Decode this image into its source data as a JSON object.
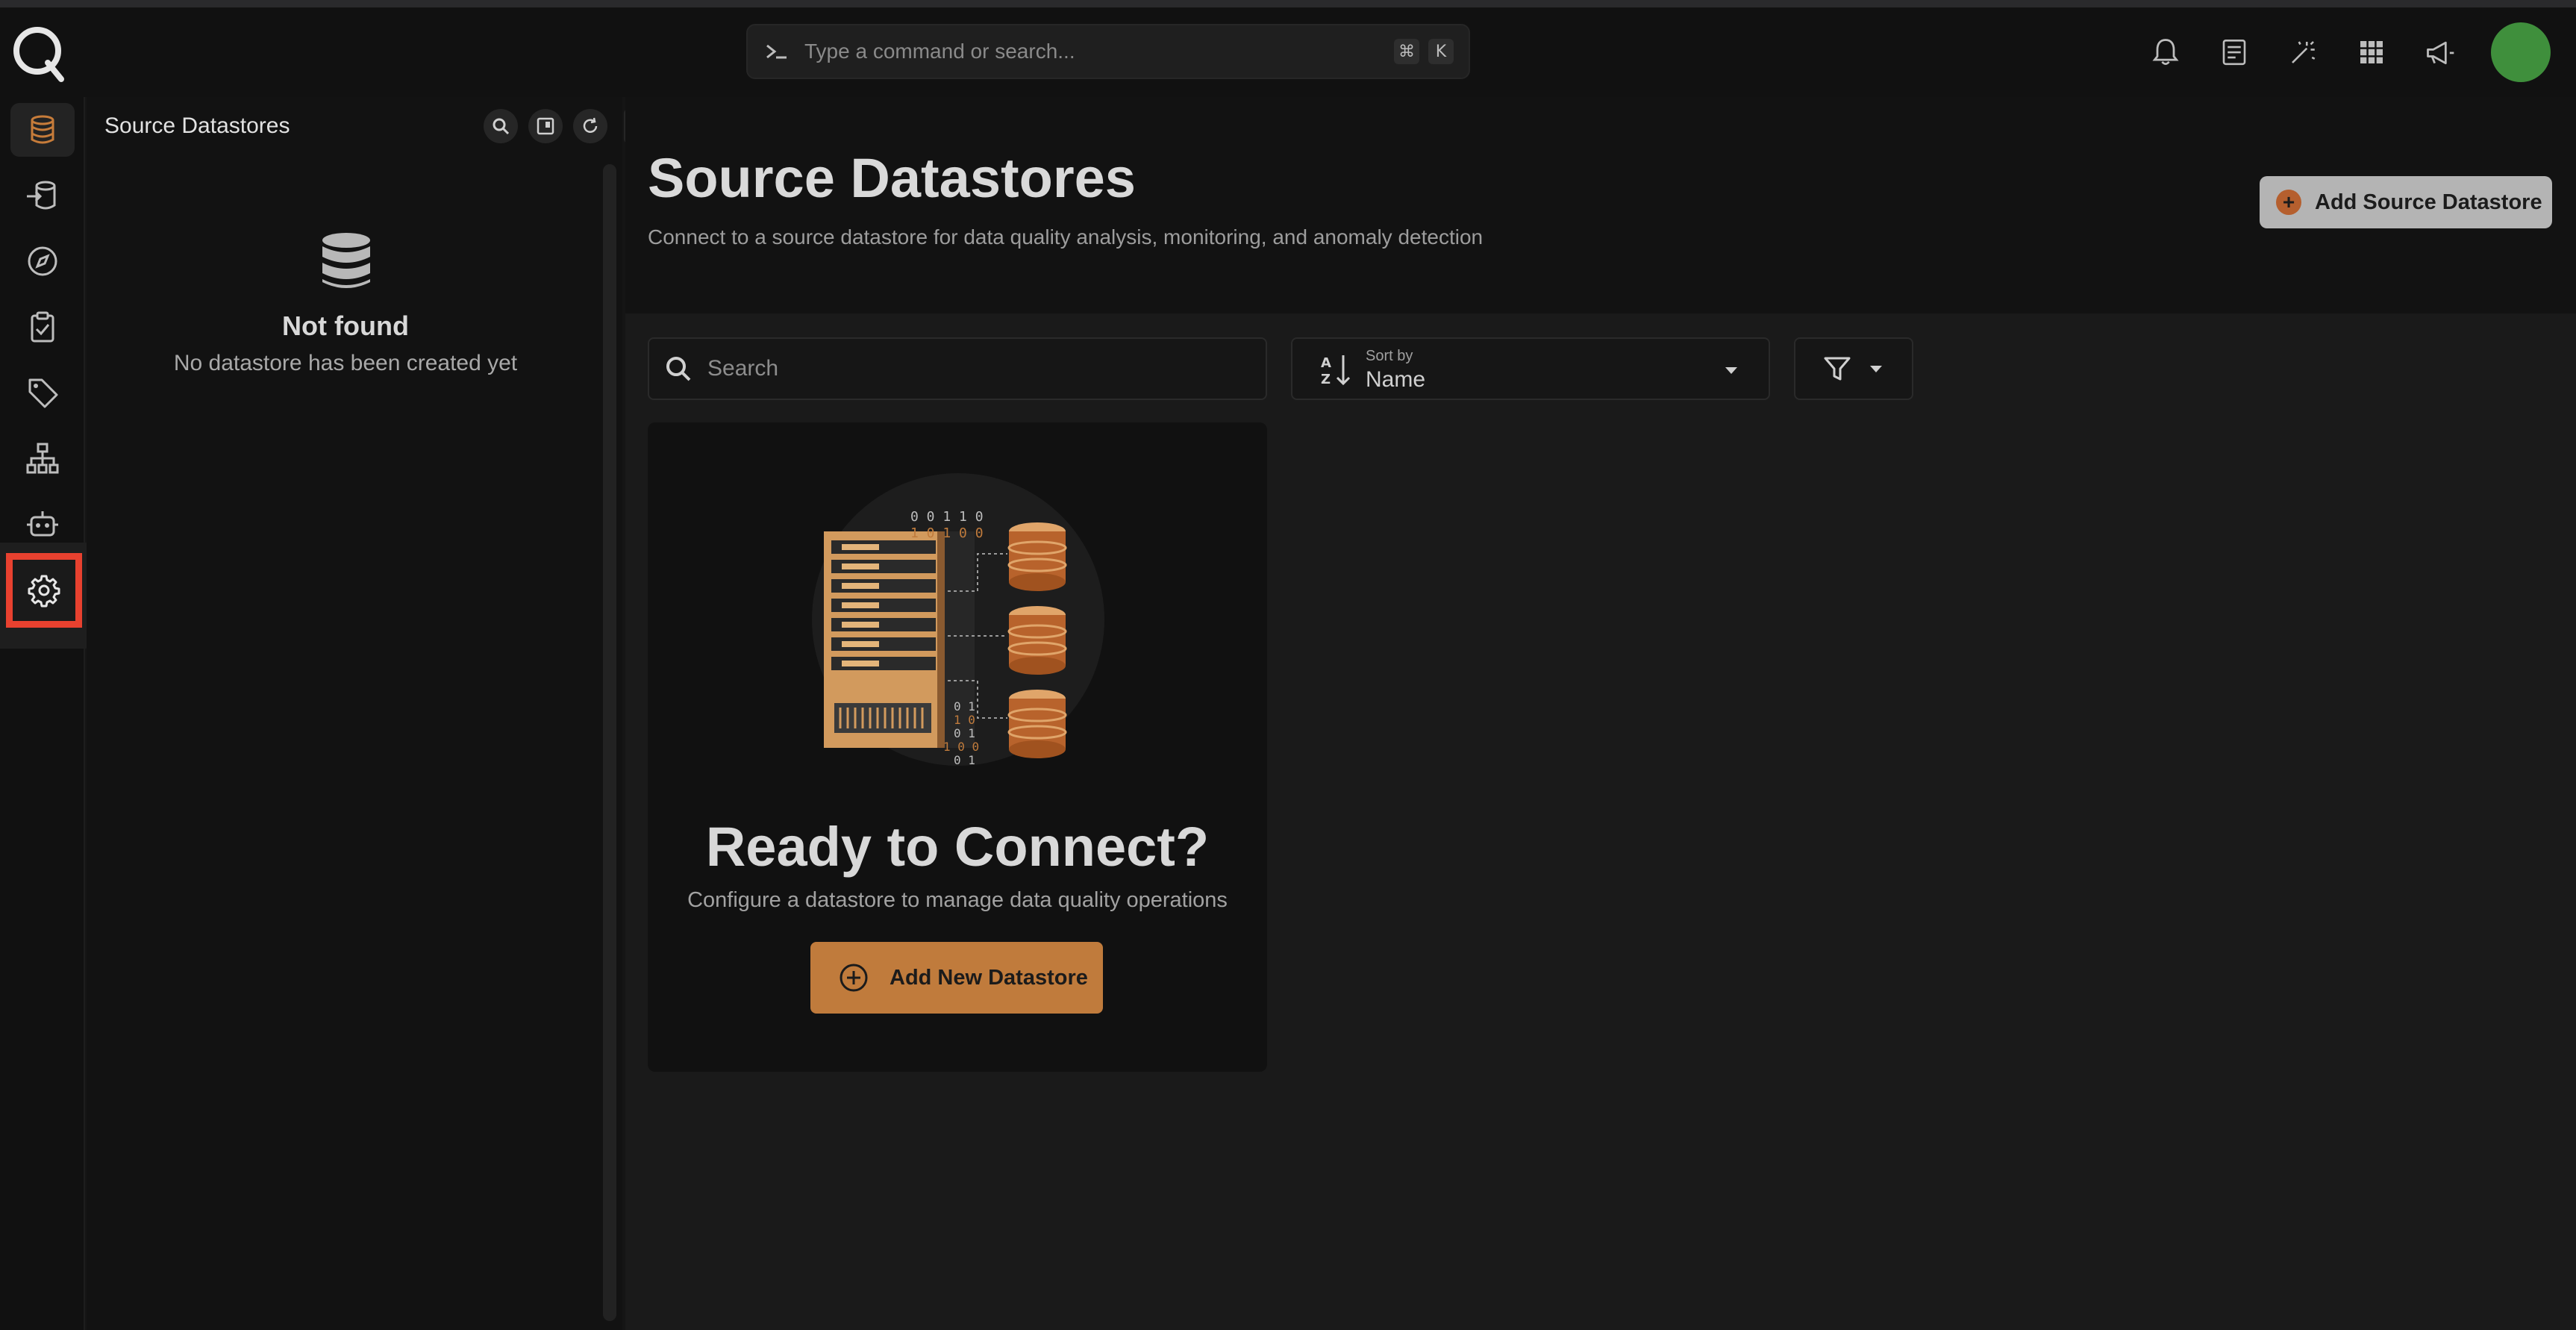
{
  "header": {
    "command_placeholder": "Type a command or search...",
    "shortcut_keys": [
      "⌘",
      "K"
    ]
  },
  "side_panel": {
    "title": "Source Datastores",
    "empty_title": "Not found",
    "empty_subtitle": "No datastore has been created yet"
  },
  "main": {
    "title": "Source Datastores",
    "subtitle": "Connect to a source datastore for data quality analysis, monitoring, and anomaly detection",
    "add_button": "Add Source Datastore",
    "search_placeholder": "Search",
    "sort_label": "Sort by",
    "sort_value": "Name",
    "empty_card": {
      "title": "Ready to Connect?",
      "subtitle": "Configure a datastore to manage data quality operations",
      "button": "Add New Datastore",
      "binary_top": [
        "0 0 1 1 0",
        "1 0 1 0 0"
      ],
      "binary_bottom": [
        "0 1",
        "1 0",
        "0 1",
        "1 0 0",
        "0 1"
      ]
    }
  },
  "colors": {
    "accent": "#c07b3c",
    "highlight": "#e8412f",
    "avatar": "#3f8f3c"
  }
}
